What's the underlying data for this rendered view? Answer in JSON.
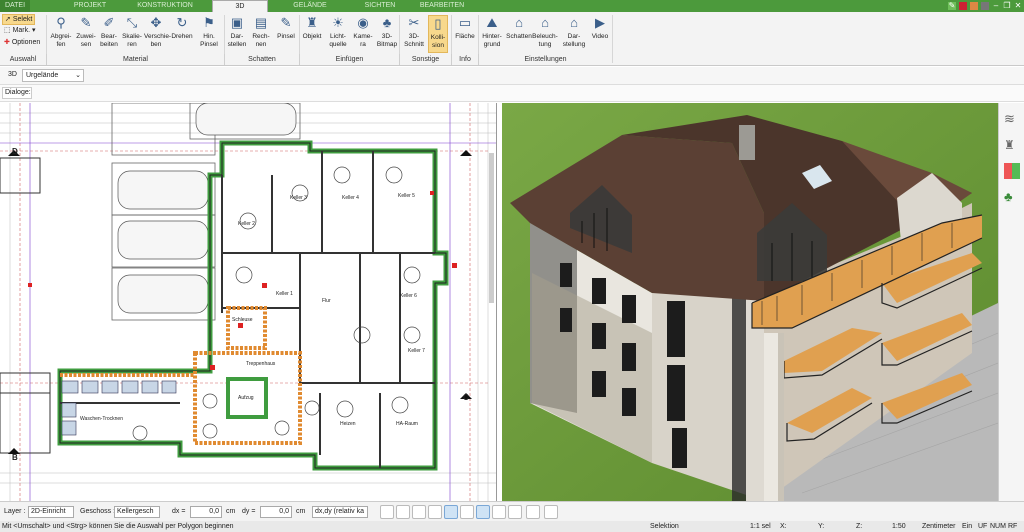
{
  "tabs": [
    {
      "label": "DATEI"
    },
    {
      "label": "PROJEKT"
    },
    {
      "label": "KONSTRUKTION"
    },
    {
      "label": "3D"
    },
    {
      "label": "GELÄNDE"
    },
    {
      "label": "SICHTEN"
    },
    {
      "label": "BEARBEITEN"
    }
  ],
  "ribbon": {
    "auswahl": {
      "selekt": "Selekt",
      "mark": "Mark.",
      "optionen": "Optionen"
    },
    "buttons": [
      {
        "label": "Abgrei-\nfen",
        "icon": "eyedropper-icon"
      },
      {
        "label": "Zuwei-\nsen",
        "icon": "brush-icon"
      },
      {
        "label": "Bear-\nbeiten",
        "icon": "edit-icon"
      },
      {
        "label": "Skalie-\nren",
        "icon": "scale-icon"
      },
      {
        "label": "Verschie-\nben",
        "icon": "move-icon"
      },
      {
        "label": "Drehen",
        "icon": "rotate-icon"
      },
      {
        "label": "Hin.\nPinsel",
        "icon": "pin-icon"
      },
      {
        "label": "Dar-\nstellen",
        "icon": "cube-icon"
      },
      {
        "label": "Rech-\nnen",
        "icon": "calc-cube-icon"
      },
      {
        "label": "Pinsel",
        "icon": "pinsel-icon"
      },
      {
        "label": "Objekt",
        "icon": "chair-icon"
      },
      {
        "label": "Licht-\nquelle",
        "icon": "bulb-icon"
      },
      {
        "label": "Kame-\nra",
        "icon": "camera-icon"
      },
      {
        "label": "3D-\nBitmap",
        "icon": "tree-icon"
      },
      {
        "label": "3D-\nSchnitt",
        "icon": "cut-icon"
      },
      {
        "label": "Kolli-\nsion",
        "icon": "collision-icon"
      },
      {
        "label": "Fläche",
        "icon": "area-icon"
      },
      {
        "label": "Hinter-\ngrund",
        "icon": "background-icon"
      },
      {
        "label": "Schatten",
        "icon": "house-shadow-icon"
      },
      {
        "label": "Beleuch-\ntung",
        "icon": "house-light-icon"
      },
      {
        "label": "Dar-\nstellung",
        "icon": "display-icon"
      },
      {
        "label": "Video",
        "icon": "play-icon"
      }
    ],
    "groups": [
      "Auswahl",
      "Material",
      "Schatten",
      "Einfügen",
      "Sonstige",
      "Info",
      "Einstellungen"
    ]
  },
  "viewbar": {
    "mode": "3D",
    "terrain": "Urgelände"
  },
  "dialogbar": {
    "label": "Dialoge:"
  },
  "plan_labels": {
    "keller1": "Keller 1",
    "keller2": "Keller 2",
    "keller3": "Keller 3",
    "keller4": "Keller 4",
    "keller5": "Keller 5",
    "keller6": "Keller 6",
    "keller7": "Keller 7",
    "flur": "Flur",
    "schleuse": "Schleuse",
    "treppenhaus": "Treppenhaus",
    "aufzug": "Aufzug",
    "waschen": "Waschen-Trocknen",
    "heizen": "Heizen",
    "hausanschluss": "HA-Raum",
    "axisB": "B",
    "axisC": "C",
    "axisD": "D"
  },
  "bottombar": {
    "layer_label": "Layer :",
    "layer_value": "2D-Einricht",
    "geschoss_label": "Geschoss :",
    "geschoss_value": "Kellergesch",
    "dx_label": "dx =",
    "dx_value": "0,0",
    "dx_unit": "cm",
    "dy_label": "dy =",
    "dy_value": "0,0",
    "dy_unit": "cm",
    "mode_value": "dx,dy (relativ ka"
  },
  "statusbar": {
    "hint": "Mit <Umschalt> und <Strg> können Sie die Auswahl per Polygon beginnen",
    "mode": "Selektion",
    "sel": "1:1 sel",
    "x": "X:",
    "y": "Y:",
    "z": "Z:",
    "scale": "1:50",
    "unit": "Zentimeter",
    "ein": "Ein",
    "uf": "UF",
    "num": "NUM",
    "rf": "RF"
  },
  "colors": {
    "ribbon_green": "#4c9a3c",
    "wall_green": "#4caf50",
    "roof": "#5a3f33",
    "balcony": "#e0a050",
    "grass": "#6f9d3a"
  }
}
